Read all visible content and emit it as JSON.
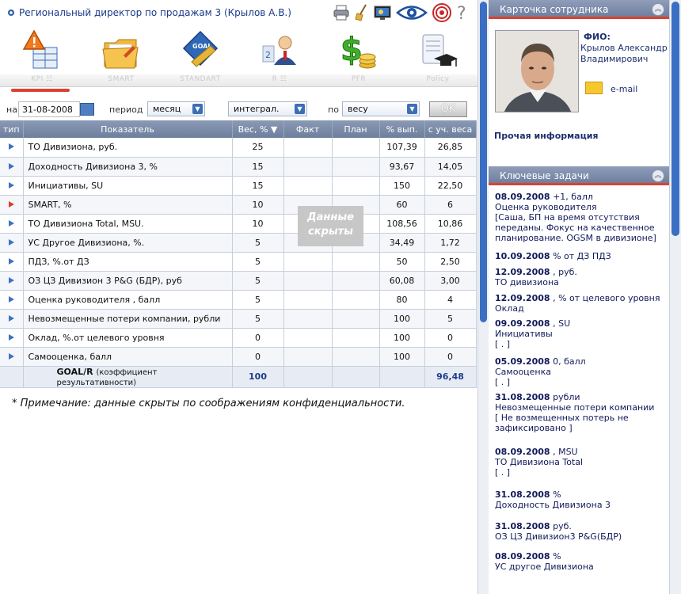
{
  "header": {
    "title": "Региональный директор по продажам 3 (Крылов А.В.)"
  },
  "toolbar_icons": [
    "printer-icon",
    "broom-icon",
    "screen-icon",
    "eye-icon",
    "target-icon",
    "help-icon"
  ],
  "nav": {
    "items": [
      {
        "label": "KPI ☷",
        "icon": "kpi-warning-chart-icon"
      },
      {
        "label": "SMART",
        "icon": "folder-icon"
      },
      {
        "label": "STANDART",
        "icon": "goal-ruler-icon"
      },
      {
        "label": "R ☷",
        "icon": "person-rank-icon"
      },
      {
        "label": "PFR",
        "icon": "dollar-coins-icon"
      },
      {
        "label": "Policy",
        "icon": "diploma-cap-icon"
      }
    ]
  },
  "filters": {
    "date_label": "на",
    "date_value": "31-08-2008",
    "period_label": "период",
    "period_value": "месяц",
    "mode_value": "интеграл.",
    "by_label": "по",
    "by_value": "весу",
    "ok_label": "OK"
  },
  "table": {
    "headers": [
      "тип",
      "Показатель",
      "Вес, %",
      "Факт",
      "План",
      "% вып.",
      "с уч. веса"
    ],
    "rows": [
      {
        "flag": "blue",
        "name": "ТО Дивизиона, руб.",
        "weight": "25",
        "fact": "",
        "plan": "",
        "pct": "107,39",
        "weighted": "26,85"
      },
      {
        "flag": "blue",
        "name": "Доходность Дивизиона 3, %",
        "weight": "15",
        "fact": "",
        "plan": "",
        "pct": "93,67",
        "weighted": "14,05"
      },
      {
        "flag": "blue",
        "name": "Инициативы, SU",
        "weight": "15",
        "fact": "",
        "plan": "",
        "pct": "150",
        "weighted": "22,50"
      },
      {
        "flag": "red",
        "name": "SMART, %",
        "weight": "10",
        "fact": "",
        "plan": "",
        "pct": "60",
        "weighted": "6"
      },
      {
        "flag": "blue",
        "name": "ТО Дивизиона Total, MSU.",
        "weight": "10",
        "fact": "",
        "plan": "",
        "pct": "108,56",
        "weighted": "10,86"
      },
      {
        "flag": "blue",
        "name": "УС Другое Дивизиона, %.",
        "weight": "5",
        "fact": "",
        "plan": "",
        "pct": "34,49",
        "weighted": "1,72"
      },
      {
        "flag": "blue",
        "name": "ПДЗ, %.от ДЗ",
        "weight": "5",
        "fact": "",
        "plan": "",
        "pct": "50",
        "weighted": "2,50"
      },
      {
        "flag": "blue",
        "name": "ОЗ ЦЗ Дивизион 3 P&G (БДР), руб",
        "weight": "5",
        "fact": "",
        "plan": "",
        "pct": "60,08",
        "weighted": "3,00"
      },
      {
        "flag": "blue",
        "name": "Оценка руководителя , балл",
        "weight": "5",
        "fact": "",
        "plan": "",
        "pct": "80",
        "weighted": "4"
      },
      {
        "flag": "blue",
        "name": "Невозмещенные потери компании, рубли",
        "weight": "5",
        "fact": "",
        "plan": "",
        "pct": "100",
        "weighted": "5"
      },
      {
        "flag": "blue",
        "name": "Оклад, %.от целевого уровня",
        "weight": "0",
        "fact": "",
        "plan": "",
        "pct": "100",
        "weighted": "0"
      },
      {
        "flag": "blue",
        "name": "Самооценка, балл",
        "weight": "0",
        "fact": "",
        "plan": "",
        "pct": "100",
        "weighted": "0"
      }
    ],
    "total": {
      "label": "GOAL/R",
      "sublabel": "(коэффициент результативности)",
      "weight": "100",
      "weighted": "96,48"
    },
    "hidden_overlay": "Данные скрыты"
  },
  "note": "* Примечание: данные скрыты по соображениям конфиденциальности.",
  "employee_card": {
    "title": "Карточка сотрудника",
    "fio_label": "ФИО:",
    "fio_value": "Крылов Александр Владимирович",
    "email_label": "e-mail",
    "other_info": "Прочая информация"
  },
  "key_tasks": {
    "title": "Ключевые задачи",
    "items": [
      {
        "date": "08.09.2008",
        "unit": "+1, балл",
        "name": "Оценка руководителя",
        "comment": "[Саша, БП на время отсутствия переданы. Фокус на качественное планирование. OGSM в дивизионе]"
      },
      {
        "date": "10.09.2008",
        "unit": "% от ДЗ ПДЗ",
        "name": "",
        "comment": ""
      },
      {
        "date": "12.09.2008",
        "unit": ", руб.",
        "name": "ТО дивизиона",
        "comment": ""
      },
      {
        "date": "12.09.2008",
        "unit": ", % от целевого уровня",
        "name": "Оклад",
        "comment": ""
      },
      {
        "date": "09.09.2008",
        "unit": ", SU",
        "name": "Инициативы",
        "comment": "[ . ]"
      },
      {
        "date": "05.09.2008",
        "unit": "0, балл",
        "name": "Самооценка",
        "comment": "[ . ]"
      },
      {
        "date": "31.08.2008",
        "unit": "рубли",
        "name": "Невозмещенные потери компании",
        "comment": "[ Не возмещенных потерь не зафиксировано ]"
      },
      {
        "date": "08.09.2008",
        "unit": ", MSU",
        "name": "ТО Дивизиона Total",
        "comment": "[ . ]"
      },
      {
        "date": "31.08.2008",
        "unit": "%",
        "name": "Доходность Дивизиона 3",
        "comment": ""
      },
      {
        "date": "31.08.2008",
        "unit": "руб.",
        "name": "ОЗ ЦЗ Дивизион3 P&G(БДР)",
        "comment": ""
      },
      {
        "date": "08.09.2008",
        "unit": "%",
        "name": "УС другое Дивизиона",
        "comment": ""
      }
    ]
  }
}
